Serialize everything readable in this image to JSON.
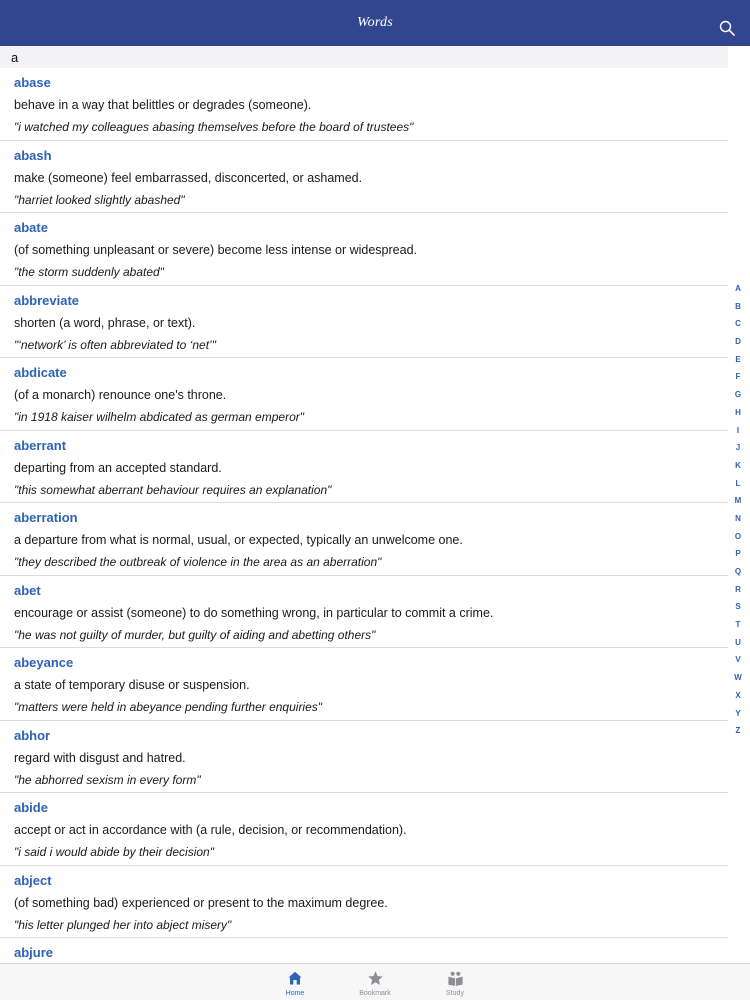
{
  "navbar": {
    "title": "Words",
    "search_icon": "search-icon"
  },
  "section": {
    "header": "a"
  },
  "entries": [
    {
      "word": "abase",
      "definition": "behave in a way that belittles or degrades (someone).",
      "example": "\"i watched my colleagues abasing themselves before the board of trustees\""
    },
    {
      "word": "abash",
      "definition": "make (someone) feel embarrassed, disconcerted, or ashamed.",
      "example": "\"harriet looked slightly abashed\""
    },
    {
      "word": "abate",
      "definition": "(of something unpleasant or severe) become less intense or widespread.",
      "example": "\"the storm suddenly abated\""
    },
    {
      "word": "abbreviate",
      "definition": "shorten (a word, phrase, or text).",
      "example": "\"‘network’ is often abbreviated to ‘net’\""
    },
    {
      "word": "abdicate",
      "definition": "(of a monarch) renounce one's throne.",
      "example": "\"in 1918 kaiser wilhelm abdicated as german emperor\""
    },
    {
      "word": "aberrant",
      "definition": "departing from an accepted standard.",
      "example": "\"this somewhat aberrant behaviour requires an explanation\""
    },
    {
      "word": "aberration",
      "definition": "a departure from what is normal, usual, or expected, typically an unwelcome one.",
      "example": "\"they described the outbreak of violence in the area as an aberration\""
    },
    {
      "word": "abet",
      "definition": "encourage or assist (someone) to do something wrong, in particular to commit a crime.",
      "example": "\"he was not guilty of murder, but guilty of aiding and abetting others\""
    },
    {
      "word": "abeyance",
      "definition": "a state of temporary disuse or suspension.",
      "example": "\"matters were held in abeyance pending further enquiries\""
    },
    {
      "word": "abhor",
      "definition": "regard with disgust and hatred.",
      "example": "\"he abhorred sexism in every form\""
    },
    {
      "word": "abide",
      "definition": "accept or act in accordance with (a rule, decision, or recommendation).",
      "example": "\"i said i would abide by their decision\""
    },
    {
      "word": "abject",
      "definition": "(of something bad) experienced or present to the maximum degree.",
      "example": "\"his letter plunged her into abject misery\""
    },
    {
      "word": "abjure",
      "definition": "",
      "example": ""
    }
  ],
  "alphabet": [
    "A",
    "B",
    "C",
    "D",
    "E",
    "F",
    "G",
    "H",
    "I",
    "J",
    "K",
    "L",
    "M",
    "N",
    "O",
    "P",
    "Q",
    "R",
    "S",
    "T",
    "U",
    "V",
    "W",
    "X",
    "Y",
    "Z"
  ],
  "tabs": [
    {
      "label": "Home",
      "icon": "home-icon",
      "active": true
    },
    {
      "label": "Bookmark",
      "icon": "star-icon",
      "active": false
    },
    {
      "label": "Study",
      "icon": "book-icon",
      "active": false
    }
  ],
  "colors": {
    "navbar": "#32468f",
    "accent": "#2f63b4",
    "inactive_tab": "#8e8e93"
  }
}
